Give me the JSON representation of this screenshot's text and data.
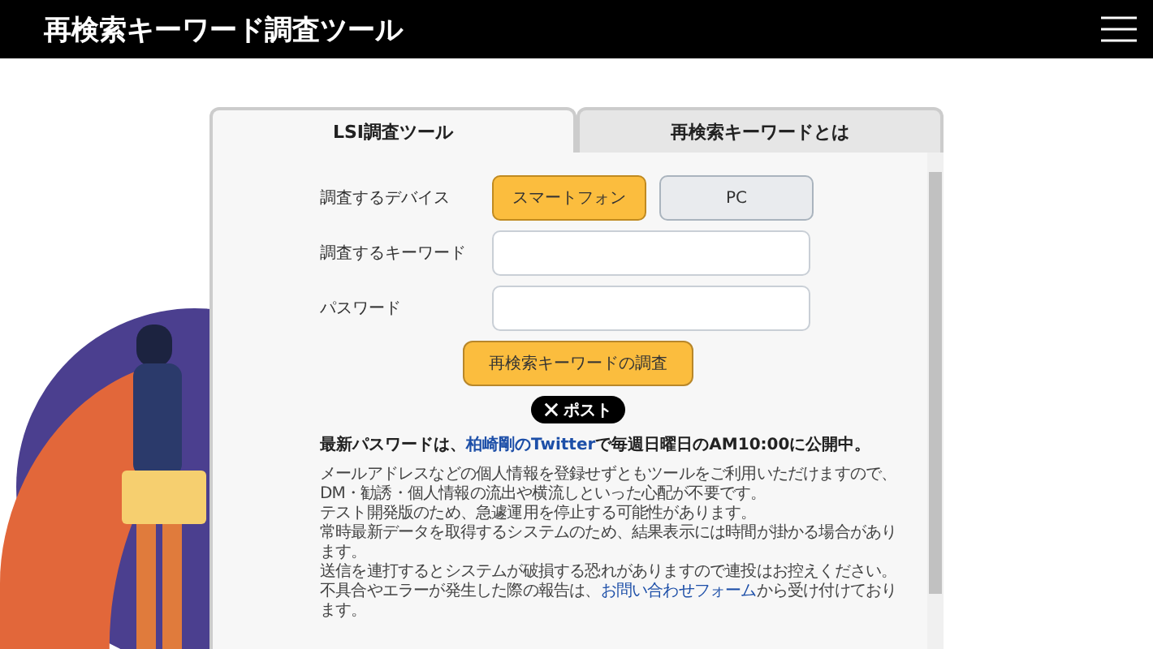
{
  "header": {
    "title": "再検索キーワード調査ツール"
  },
  "tabs": [
    {
      "label": "LSI調査ツール",
      "selected": true
    },
    {
      "label": "再検索キーワードとは",
      "selected": false
    }
  ],
  "form": {
    "device_label": "調査するデバイス",
    "devices": [
      {
        "label": "スマートフォン",
        "selected": true
      },
      {
        "label": "PC",
        "selected": false
      }
    ],
    "keyword_label": "調査するキーワード",
    "password_label": "パスワード",
    "submit": "再検索キーワードの調査"
  },
  "post_button": "ポスト",
  "notice": {
    "before": "最新パスワードは、",
    "link": "柏崎剛のTwitter",
    "after": "で毎週日曜日のAM10:00に公開中。"
  },
  "notes": [
    {
      "kind": "text",
      "text": "メールアドレスなどの個人情報を登録せずともツールをご利用いただけますので、DM・勧誘・個人情報の流出や横流しといった心配が不要です。"
    },
    {
      "kind": "text",
      "text": "テスト開発版のため、急遽運用を停止する可能性があります。"
    },
    {
      "kind": "text",
      "text": "常時最新データを取得するシステムのため、結果表示には時間が掛かる場合があります。"
    },
    {
      "kind": "text",
      "text": "送信を連打するとシステムが破損する恐れがありますので連投はお控えください。"
    },
    {
      "kind": "link",
      "before": "不具合やエラーが発生した際の報告は、",
      "link": "お問い合わせフォーム",
      "after": "から受け付けております。"
    }
  ]
}
